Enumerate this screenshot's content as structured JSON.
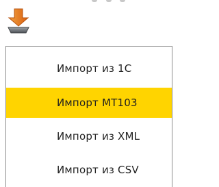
{
  "toolbar": {
    "import_icon": "import-down-arrow-icon"
  },
  "menu": {
    "items": [
      {
        "label": "Импорт из 1С",
        "active": false
      },
      {
        "label": "Импорт MT103",
        "active": true
      },
      {
        "label": "Импорт из XML",
        "active": false
      },
      {
        "label": "Импорт из CSV",
        "active": false
      }
    ]
  },
  "colors": {
    "highlight": "#ffd400",
    "arrow_orange": "#e77a1a",
    "border": "#8a8a8a"
  }
}
